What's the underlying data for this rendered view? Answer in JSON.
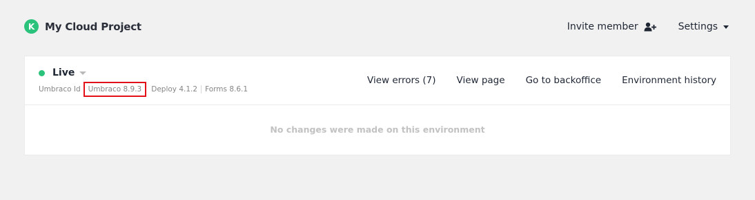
{
  "header": {
    "logo_letter": "K",
    "project_name": "My Cloud Project",
    "invite_label": "Invite member",
    "settings_label": "Settings"
  },
  "environment": {
    "name": "Live",
    "status": "online",
    "status_color": "#2bc37c",
    "versions": {
      "umbraco_id": "Umbraco Id",
      "umbraco": "Umbraco 8.9.3",
      "deploy": "Deploy 4.1.2",
      "forms": "Forms 8.6.1"
    },
    "actions": {
      "view_errors": "View errors (7)",
      "view_page": "View page",
      "backoffice": "Go to backoffice",
      "history": "Environment history"
    },
    "empty_message": "No changes were made on this environment"
  },
  "colors": {
    "accent": "#2bc37c",
    "highlight_box": "#e30f17",
    "background": "#f1f1f1"
  }
}
